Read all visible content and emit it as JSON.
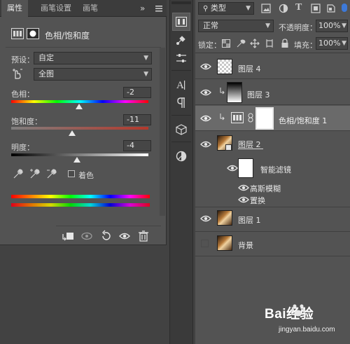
{
  "properties": {
    "tabs": [
      "属性",
      "画笔设置",
      "画笔"
    ],
    "tab_more": "»",
    "title": "色相/饱和度",
    "preset_label": "预设：",
    "preset_value": "自定",
    "channel_value": "全图",
    "hue": {
      "label": "色相：",
      "value": "-2",
      "level": -2,
      "min": -180,
      "max": 180
    },
    "saturation": {
      "label": "饱和度：",
      "value": "-11",
      "level": -11,
      "min": -100,
      "max": 100
    },
    "lightness": {
      "label": "明度：",
      "value": "-4",
      "level": -4,
      "min": -100,
      "max": 100
    },
    "colorize_label": "着色"
  },
  "layers": {
    "kind_filter": "类型",
    "blend_mode": "正常",
    "opacity_label": "不透明度：",
    "opacity_value": "100%",
    "lock_label": "锁定：",
    "fill_label": "填充：",
    "fill_value": "100%",
    "items": [
      {
        "name": "图层 4"
      },
      {
        "name": "图层 3"
      },
      {
        "name": "色相/饱和度 1"
      },
      {
        "name": "图层 2"
      },
      {
        "name": "智能滤镜"
      },
      {
        "name": "高斯模糊"
      },
      {
        "name": "置换"
      },
      {
        "name": "图层 1"
      },
      {
        "name": "背景"
      }
    ]
  },
  "watermark": {
    "brand": "Bai经验",
    "url": "jingyan.baidu.com"
  },
  "colors": {
    "panel": "#535353",
    "dark": "#3a3a3a",
    "selected_row": "#6a6a6a",
    "accent_red": "#b4382b"
  },
  "icons": [
    "hue-saturation-icon",
    "mask-icon",
    "targeted-adjust-icon",
    "eyedropper-icon",
    "eyedropper-plus-icon",
    "eyedropper-minus-icon",
    "clip-to-layer-icon",
    "view-previous-icon",
    "reset-icon",
    "visibility-icon",
    "trash-icon",
    "eye-icon",
    "link-icon"
  ]
}
